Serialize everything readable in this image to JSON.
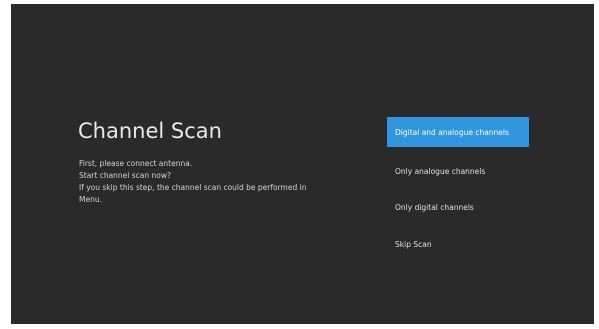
{
  "screen": {
    "title": "Channel Scan",
    "description": [
      "First, please connect antenna.",
      "Start channel scan now?",
      "If you skip this step, the channel scan could be performed in",
      "Menu."
    ]
  },
  "options": [
    {
      "label": "Digital and analogue channels",
      "selected": true
    },
    {
      "label": "Only analogue channels",
      "selected": false
    },
    {
      "label": "Only digital channels",
      "selected": false
    },
    {
      "label": "Skip Scan",
      "selected": false
    }
  ],
  "colors": {
    "background": "#2a2a2a",
    "accent": "#2f96df",
    "text": "#e8e8e8"
  }
}
